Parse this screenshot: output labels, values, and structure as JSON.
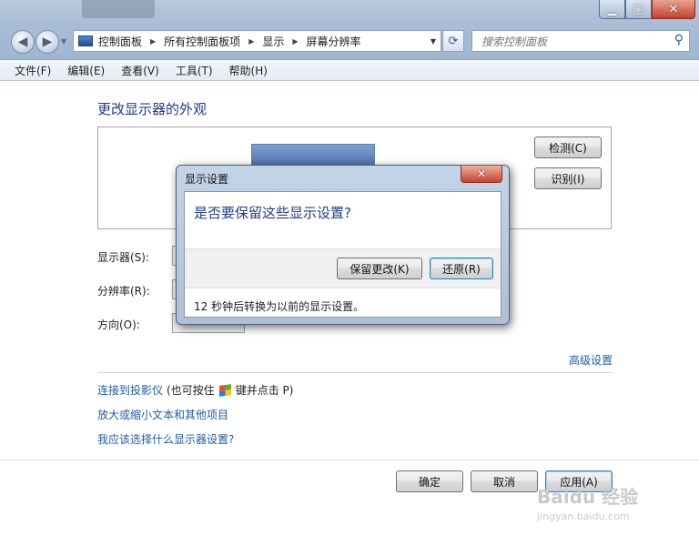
{
  "window": {
    "caption_buttons": {
      "minimize": "▁",
      "maximize": "□",
      "close": "✕"
    }
  },
  "nav": {
    "back_icon": "back-arrow-icon",
    "forward_icon": "forward-arrow-icon",
    "breadcrumbs": [
      "控制面板",
      "所有控制面板项",
      "显示",
      "屏幕分辨率"
    ],
    "search_placeholder": "搜索控制面板"
  },
  "menu": [
    "文件(F)",
    "编辑(E)",
    "查看(V)",
    "工具(T)",
    "帮助(H)"
  ],
  "main": {
    "heading": "更改显示器的外观",
    "detect_button": "检测(C)",
    "identify_button": "识别(I)",
    "display_label": "显示器(S):",
    "resolution_label": "分辨率(R):",
    "orientation_label": "方向(O):",
    "advanced_link": "高级设置",
    "projector_link": "连接到投影仪",
    "projector_hint_pre": "(也可按住",
    "projector_hint_post": "键并点击 P)",
    "text_size_link": "放大或缩小文本和其他项目",
    "which_settings_link": "我应该选择什么显示器设置?",
    "ok_button": "确定",
    "cancel_button": "取消",
    "apply_button": "应用(A)"
  },
  "dialog": {
    "title": "显示设置",
    "question": "是否要保留这些显示设置?",
    "keep_button": "保留更改(K)",
    "revert_button": "还原(R)",
    "countdown_note": "12 秒钟后转换为以前的显示设置。"
  },
  "watermark": {
    "line1": "Baidu 经验",
    "line2": "jingyan.baidu.com"
  },
  "colors": {
    "link": "#1f5ca8",
    "heading": "#1f3d8a",
    "close": "#c9432b"
  }
}
